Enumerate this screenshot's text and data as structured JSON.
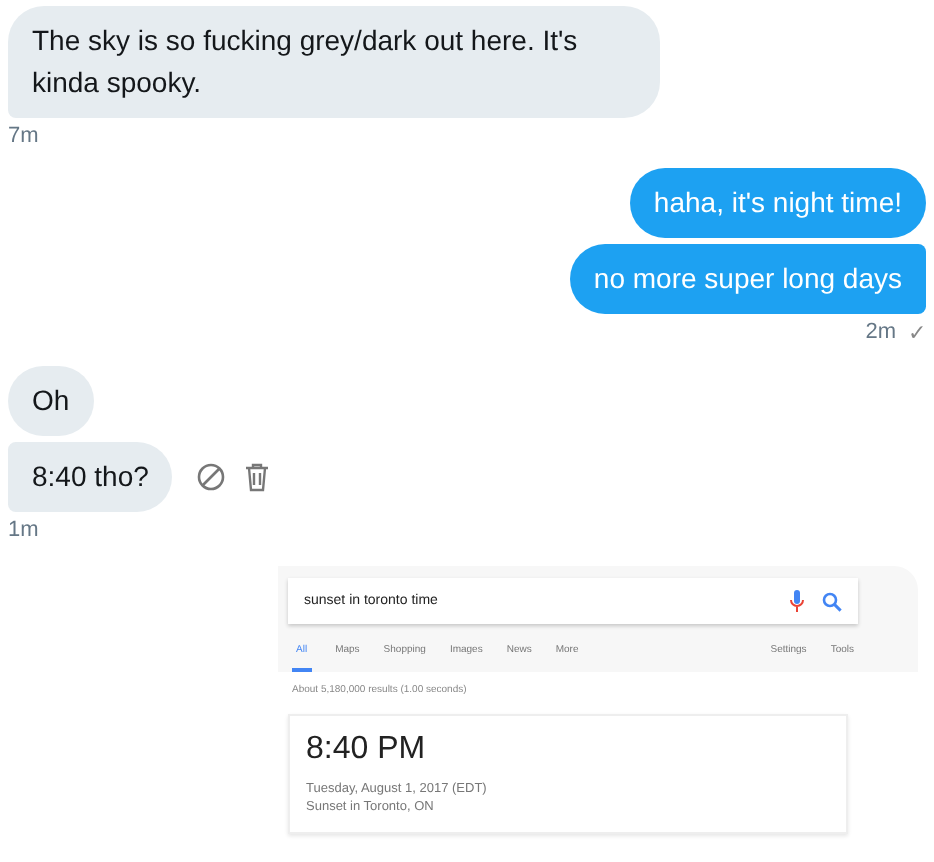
{
  "groups": [
    {
      "kind": "received",
      "time": "7m",
      "messages": [
        {
          "kind": "text",
          "text": "The sky is so fucking grey/dark out here. It's kinda spooky.",
          "actions": false
        }
      ]
    },
    {
      "kind": "sent",
      "time": "2m",
      "receipt": "✓",
      "messages": [
        {
          "kind": "text",
          "text": "haha, it's night time!",
          "actions": false
        },
        {
          "kind": "text",
          "text": "no more super long days",
          "actions": false
        }
      ]
    },
    {
      "kind": "received",
      "time": "1m",
      "messages": [
        {
          "kind": "text",
          "text": "Oh",
          "actions": false
        },
        {
          "kind": "text",
          "text": "8:40 tho?",
          "actions": true
        }
      ]
    },
    {
      "kind": "sent",
      "messages": [
        {
          "kind": "screenshot",
          "query": "sunset in toronto time",
          "tabs": [
            {
              "label": "All",
              "selected": true
            },
            {
              "label": "Maps",
              "selected": false
            },
            {
              "label": "Shopping",
              "selected": false
            },
            {
              "label": "Images",
              "selected": false
            },
            {
              "label": "News",
              "selected": false
            },
            {
              "label": "More",
              "selected": false
            }
          ],
          "tools": [
            "Settings",
            "Tools"
          ],
          "stats": "About 5,180,000 results (1.00 seconds)",
          "answer": "8:40 PM",
          "date": "Tuesday, August 1, 2017 (EDT)",
          "place": "Sunset in Toronto, ON"
        }
      ]
    }
  ]
}
